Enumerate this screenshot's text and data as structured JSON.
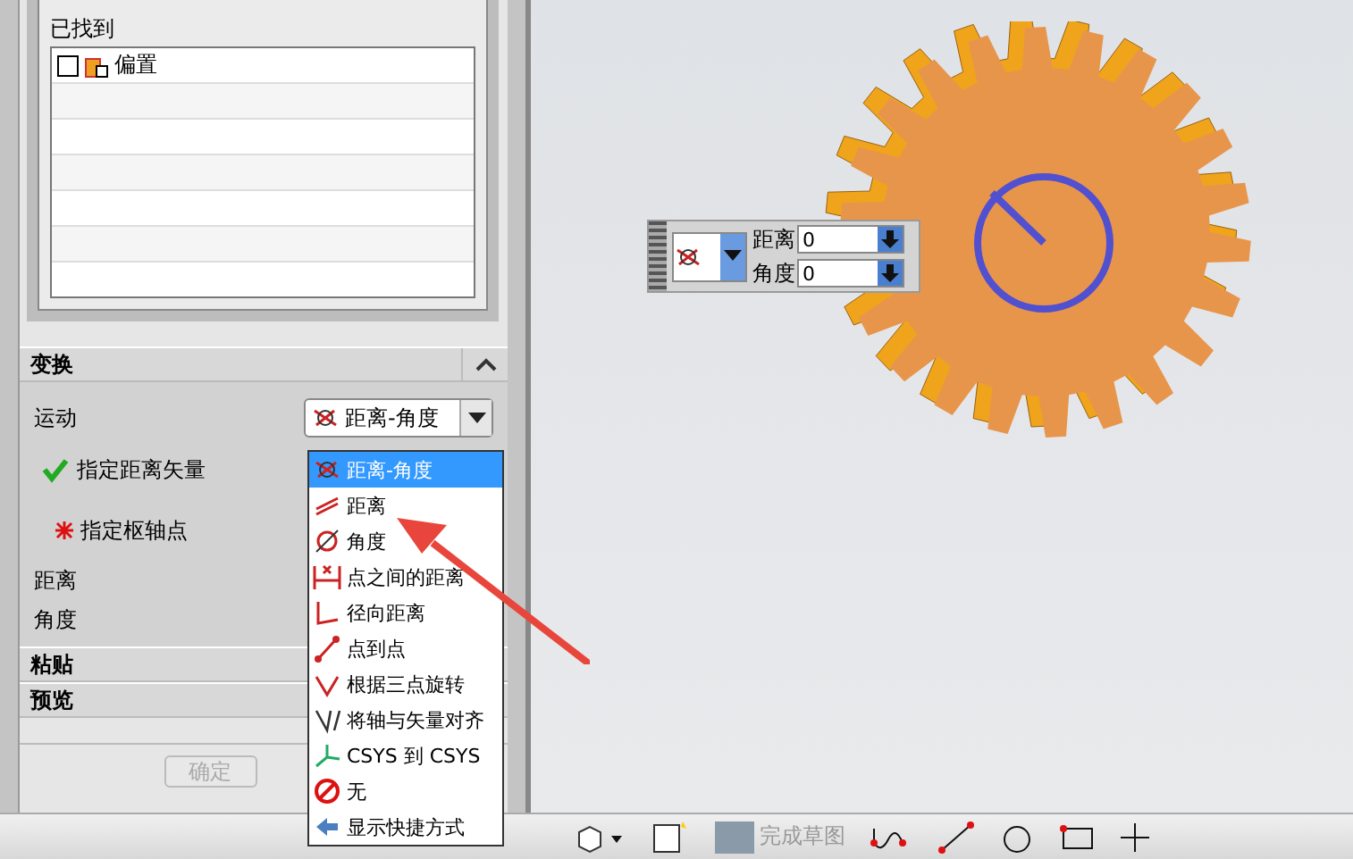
{
  "selection": {
    "found_label": "已找到",
    "items": [
      {
        "label": "偏置",
        "checked": false
      }
    ]
  },
  "sections": [
    {
      "title": "变换",
      "expanded": true
    },
    {
      "title": "粘贴"
    },
    {
      "title": "预览"
    }
  ],
  "transform": {
    "motion_label": "运动",
    "motion_value": "距离-角度",
    "fields": [
      {
        "kind": "check",
        "label": "指定距离矢量"
      },
      {
        "kind": "required",
        "label": "指定枢轴点"
      },
      {
        "kind": "plain",
        "label": "距离"
      },
      {
        "kind": "plain",
        "label": "角度"
      }
    ]
  },
  "buttons": [
    {
      "label": "确定",
      "disabled": true
    }
  ],
  "motion_menu": {
    "items": [
      {
        "label": "距离-角度",
        "selected": true
      },
      {
        "label": "距离",
        "selected": false
      },
      {
        "label": "角度",
        "selected": false
      },
      {
        "label": "点之间的距离",
        "selected": false
      },
      {
        "label": "径向距离",
        "selected": false
      },
      {
        "label": "点到点",
        "selected": false
      },
      {
        "label": "根据三点旋转",
        "selected": false
      },
      {
        "label": "将轴与矢量对齐",
        "selected": false
      },
      {
        "label": "CSYS 到 CSYS",
        "selected": false
      },
      {
        "label": "无",
        "selected": false
      },
      {
        "label": "显示快捷方式",
        "selected": false
      }
    ]
  },
  "float_toolbar": {
    "fields": [
      {
        "label": "距离",
        "value": "0"
      },
      {
        "label": "角度",
        "value": "0"
      }
    ]
  },
  "bottom_toolbar": {
    "finish_sketch": {
      "label": "完成草图",
      "disabled": true
    }
  }
}
